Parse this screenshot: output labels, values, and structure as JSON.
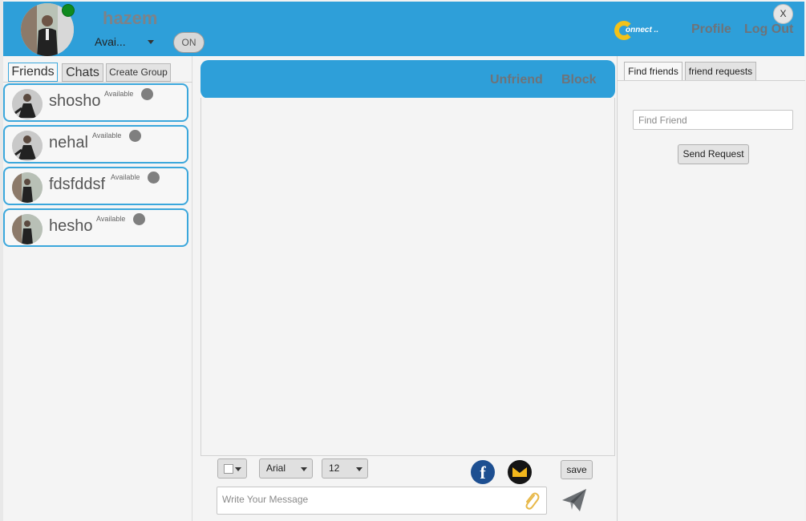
{
  "header": {
    "username": "hazem",
    "status_value": "Avai...",
    "toggle_label": "ON",
    "logo_text": "onnect ..",
    "profile_label": "Profile",
    "logout_label": "Log Out",
    "close_label": "X"
  },
  "left_tabs": {
    "friends": "Friends",
    "chats": "Chats",
    "create_group": "Create Group"
  },
  "friends": [
    {
      "name": "shosho",
      "status": "Available",
      "avatar": "avatar-icon"
    },
    {
      "name": "nehal",
      "status": "Available",
      "avatar": "avatar-icon"
    },
    {
      "name": "fdsfddsf",
      "status": "Available",
      "avatar": "avatar-icon"
    },
    {
      "name": "hesho",
      "status": "Available",
      "avatar": "avatar-icon"
    }
  ],
  "chat": {
    "unfriend_label": "Unfriend",
    "block_label": "Block",
    "font_family": "Arial",
    "font_size": "12",
    "save_label": "save",
    "message_placeholder": "Write Your Message",
    "facebook_glyph": "f"
  },
  "right_tabs": {
    "find_friends": "Find friends",
    "friend_requests": "friend requests"
  },
  "find": {
    "placeholder": "Find Friend",
    "send_request_label": "Send Request"
  },
  "colors": {
    "accent": "#2e9fd9",
    "online": "#0f8a1f",
    "status_dot": "#7f7f7f"
  }
}
